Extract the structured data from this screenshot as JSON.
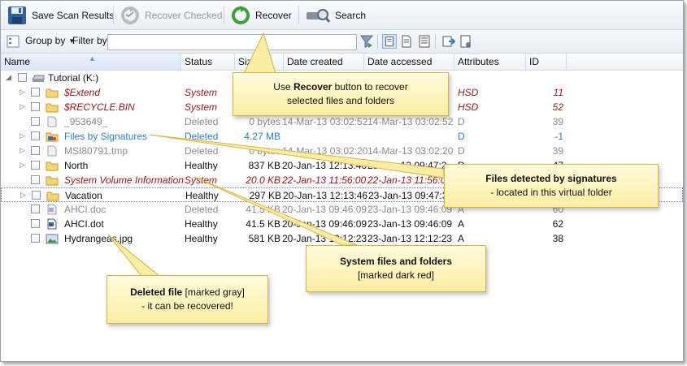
{
  "toolbar": {
    "save_label": "Save Scan Results",
    "recover_checked_label": "Recover Checked",
    "recover_label": "Recover",
    "search_label": "Search"
  },
  "filterbar": {
    "group_by_label": "Group by",
    "filter_by_label": "Filter by:",
    "filter_value": ""
  },
  "columns": [
    "Name",
    "Status",
    "Size",
    "Date created",
    "Date accessed",
    "Attributes",
    "ID"
  ],
  "root": {
    "label": "Tutorial (K:)"
  },
  "rows": [
    {
      "name": "$Extend",
      "status": "System",
      "size": "",
      "created": "",
      "accessed": "",
      "attributes": "HSD",
      "id": "11"
    },
    {
      "name": "$RECYCLE.BIN",
      "status": "System",
      "size": "",
      "created": "",
      "accessed": "",
      "attributes": "HSD",
      "id": "52"
    },
    {
      "name": "_953649_",
      "status": "Deleted",
      "size": "0 bytes",
      "created": "14-Mar-13 03:02:52",
      "accessed": "14-Mar-13 03:02:52",
      "attributes": "D",
      "id": "39"
    },
    {
      "name": "Files by Signatures",
      "status": "Deleted",
      "size": "4.27 MB",
      "created": "",
      "accessed": "",
      "attributes": "D",
      "id": "-1"
    },
    {
      "name": "MSI80791.tmp",
      "status": "Deleted",
      "size": "0 bytes",
      "created": "14-Mar-13 03:02:20",
      "accessed": "14-Mar-13 03:02:20",
      "attributes": "D",
      "id": "39"
    },
    {
      "name": "North",
      "status": "Healthy",
      "size": "837 KB",
      "created": "20-Jan-13 12:13:46",
      "accessed": "23-Jan-13 09:47:2",
      "attributes": "D",
      "id": "47"
    },
    {
      "name": "System Volume Information",
      "status": "System",
      "size": "20.0 KB",
      "created": "22-Jan-13 11:56:00",
      "accessed": "22-Jan-13 11:56:00",
      "attributes": "HSD",
      "id": "31"
    },
    {
      "name": "Vacation",
      "status": "Healthy",
      "size": "297 KB",
      "created": "20-Jan-13 12:13:46",
      "accessed": "23-Jan-13 09:47:33",
      "attributes": "D",
      "id": "46"
    },
    {
      "name": "AHCI.doc",
      "status": "Deleted",
      "size": "41.5 KB",
      "created": "20-Jan-13 09:46:09",
      "accessed": "23-Jan-13 09:46:09",
      "attributes": "A",
      "id": "60"
    },
    {
      "name": "AHCI.dot",
      "status": "Healthy",
      "size": "41.5 KB",
      "created": "20-Jan-13 09:46:09",
      "accessed": "23-Jan-13 09:46:09",
      "attributes": "A",
      "id": "62"
    },
    {
      "name": "Hydrangeas.jpg",
      "status": "Healthy",
      "size": "581 KB",
      "created": "20-Jan-13 12:12:23",
      "accessed": "23-Jan-13 12:12:23",
      "attributes": "A",
      "id": "38"
    }
  ],
  "callouts": {
    "recover": {
      "pre": "Use ",
      "bold": "Recover",
      "post": " button to recover",
      "line2": "selected files and folders"
    },
    "signatures": {
      "bold": "Files detected by signatures",
      "line2": "- located in this virtual folder"
    },
    "system": {
      "bold": "System files and folders",
      "line2": "[marked dark red]"
    },
    "deleted": {
      "bold": "Deleted file",
      "post": " [marked gray]",
      "line2": "- it can be recovered!"
    }
  },
  "colors": {
    "system": "#a31515",
    "deleted": "#8c8c8c",
    "signature": "#2a7fd4",
    "callout_fill": "#fbeea4"
  }
}
